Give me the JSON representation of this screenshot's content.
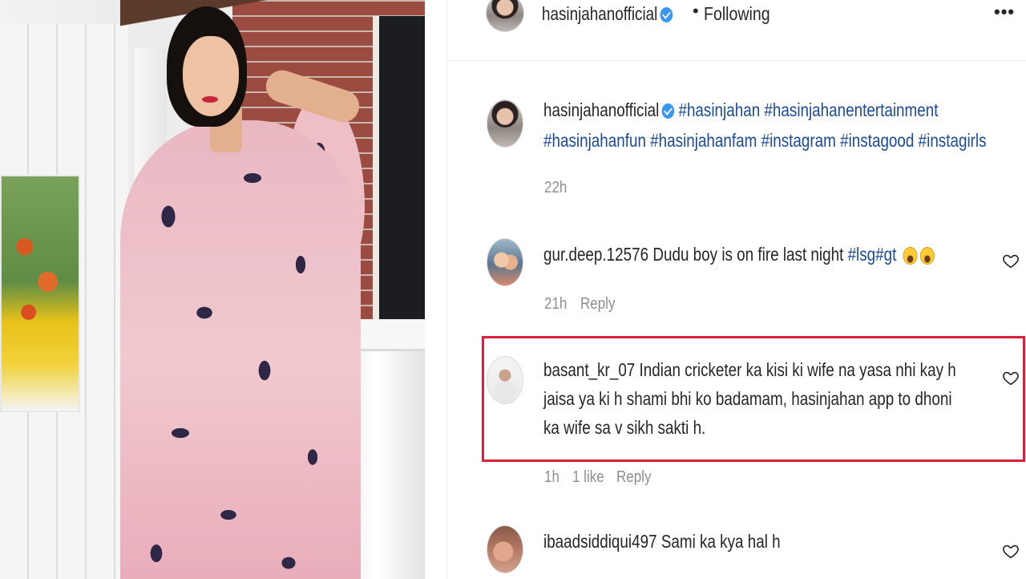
{
  "header": {
    "username": "hasinjahanofficial",
    "separator": "•",
    "follow_status": "Following",
    "more_label": "•••"
  },
  "caption": {
    "username": "hasinjahanofficial",
    "hashtags_line1": "#hasinjahan #hasinjahanentertainment",
    "hashtags_line2": "#hasinjahanfun #hasinjahanfam #instagram #instagood #instagirls",
    "time": "22h"
  },
  "comments": [
    {
      "username": "gur.deep.12576",
      "text": "Dudu boy is on fire last night ",
      "hashtags": "#lsg#gt",
      "time": "21h",
      "reply_label": "Reply",
      "emoji": "grinning-face-emoji"
    },
    {
      "username": "basant_kr_07",
      "line1": "Indian cricketer ka kisi ki wife na yasa nhi kay h",
      "line2": "jaisa ya ki h shami bhi ko badamam, hasinjahan app to dhoni",
      "line3": "ka wife sa v sikh sakti h.",
      "time": "1h",
      "likes": "1 like",
      "reply_label": "Reply"
    },
    {
      "username": "ibaadsiddiqui497",
      "text": "Sami ka kya hal h"
    }
  ],
  "colors": {
    "highlight_border": "#d8203a",
    "hashtag": "#1a4a9a",
    "verified_badge": "#3897f0",
    "meta_text": "#8e8e8e"
  }
}
